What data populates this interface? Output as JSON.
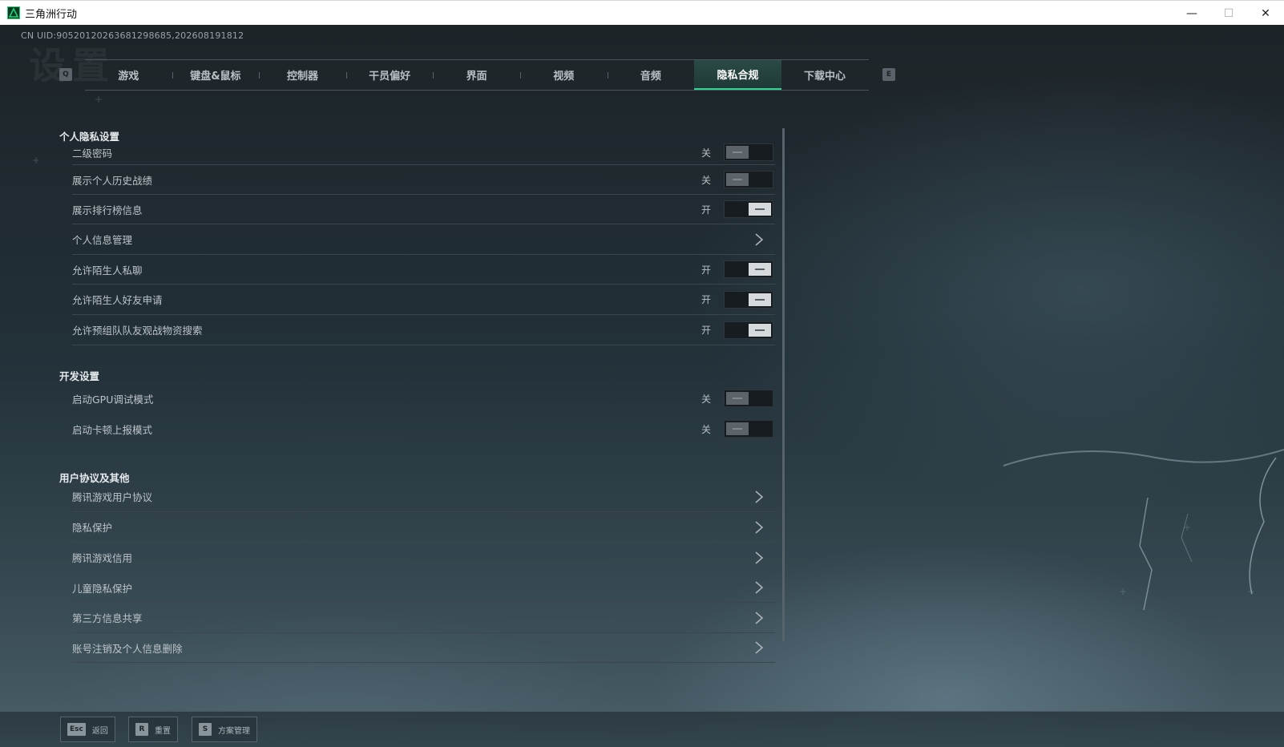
{
  "window": {
    "title": "三角洲行动",
    "minimize": "—",
    "maximize": "☐",
    "close": "✕"
  },
  "uid": "CN UID:9052012026368129868​5,2026​08191812",
  "page_word": "设置",
  "tabs": {
    "left_key": "Q",
    "right_key": "E",
    "items": [
      {
        "label": "游戏"
      },
      {
        "label": "键盘&鼠标"
      },
      {
        "label": "控制器"
      },
      {
        "label": "干员偏好"
      },
      {
        "label": "界面"
      },
      {
        "label": "视频"
      },
      {
        "label": "音频"
      },
      {
        "label": "隐私合规",
        "active": true
      },
      {
        "label": "下载中心"
      }
    ]
  },
  "sections": {
    "privacy": {
      "title": "个人隐私设置",
      "rows": [
        {
          "label": "二级密码",
          "state": "关",
          "on": false
        },
        {
          "label": "展示个人历史战绩",
          "state": "关",
          "on": false
        },
        {
          "label": "展示排行榜信息",
          "state": "开",
          "on": true
        },
        {
          "label": "个人信息管理"
        },
        {
          "label": "允许陌生人私聊",
          "state": "开",
          "on": true
        },
        {
          "label": "允许陌生人好友申请",
          "state": "开",
          "on": true
        },
        {
          "label": "允许预组队队友观战物资搜索",
          "state": "开",
          "on": true
        }
      ]
    },
    "dev": {
      "title": "开发设置",
      "rows": [
        {
          "label": "启动GPU调试模式",
          "state": "关",
          "on": false
        },
        {
          "label": "启动卡顿上报模式",
          "state": "关",
          "on": false
        }
      ]
    },
    "agreements": {
      "title": "用户协议及其他",
      "rows": [
        {
          "label": "腾讯游戏用户协议"
        },
        {
          "label": "隐私保护"
        },
        {
          "label": "腾讯游戏信用"
        },
        {
          "label": "儿童隐私保护"
        },
        {
          "label": "第三方信息共享"
        },
        {
          "label": "账号注销及个人信息删除"
        }
      ]
    }
  },
  "bottom": {
    "back": {
      "key": "Esc",
      "label": "返回"
    },
    "reset": {
      "key": "R",
      "label": "重置"
    },
    "scheme": {
      "key": "S",
      "label": "方案管理"
    }
  }
}
